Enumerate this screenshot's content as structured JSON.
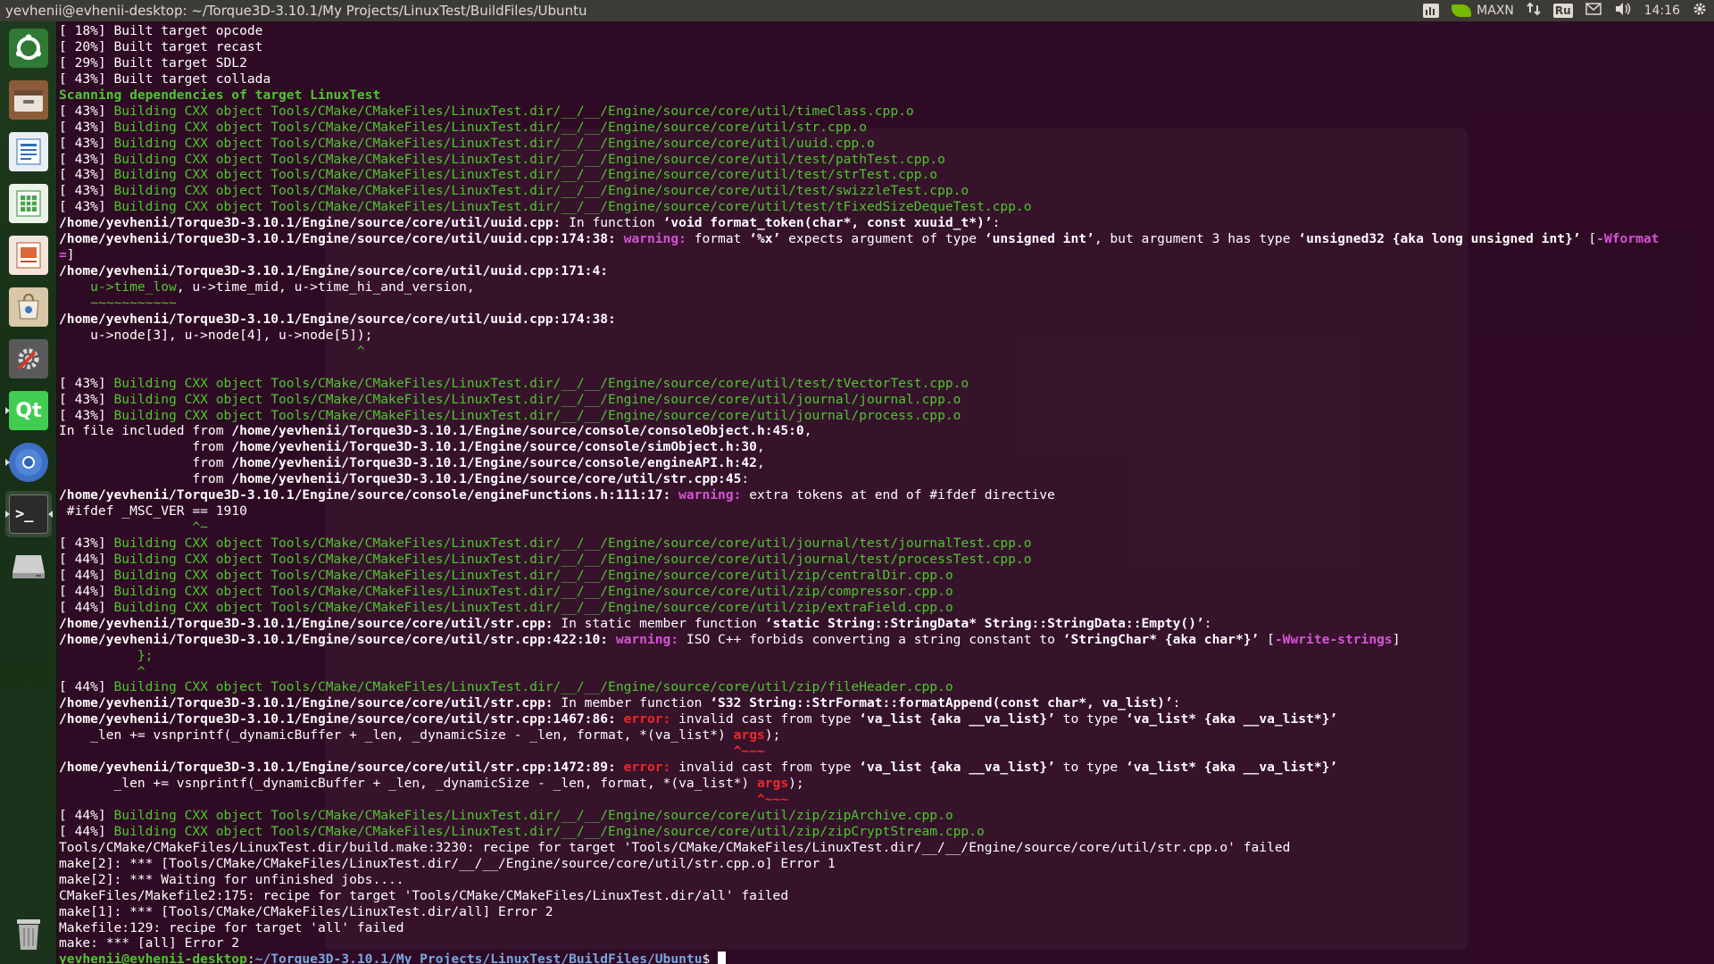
{
  "window_title": "yevhenii@evhenii-desktop: ~/Torque3D-3.10.1/My Projects/LinuxTest/BuildFiles/Ubuntu",
  "indicators": {
    "perf_mode": "MAXN",
    "keyboard_layout": "Ru",
    "time": "14:16"
  },
  "launcher": [
    {
      "name": "ubuntu-dash-icon",
      "label": ""
    },
    {
      "name": "files-icon",
      "label": ""
    },
    {
      "name": "libreoffice-writer-icon",
      "label": ""
    },
    {
      "name": "libreoffice-calc-icon",
      "label": ""
    },
    {
      "name": "libreoffice-impress-icon",
      "label": ""
    },
    {
      "name": "software-center-icon",
      "label": ""
    },
    {
      "name": "system-settings-icon",
      "label": ""
    },
    {
      "name": "qt-creator-icon",
      "label": "Qt"
    },
    {
      "name": "chromium-icon",
      "label": ""
    },
    {
      "name": "terminal-icon",
      "label": ">_"
    },
    {
      "name": "drive-icon",
      "label": ""
    },
    {
      "name": "trash-icon",
      "label": ""
    }
  ],
  "colors": {
    "terminal_bg": "#300a24",
    "green": "#4ec72d",
    "warning": "#d454d4",
    "error": "#ef2929",
    "prompt_path": "#7aa7e0"
  },
  "terminal_lines": [
    [
      [
        "d",
        "[ 18%] Built target opcode"
      ]
    ],
    [
      [
        "d",
        "[ 20%] Built target recast"
      ]
    ],
    [
      [
        "d",
        "[ 29%] Built target SDL2"
      ]
    ],
    [
      [
        "d",
        "[ 43%] Built target collada"
      ]
    ],
    [
      [
        "gb",
        "Scanning dependencies of target LinuxTest"
      ]
    ],
    [
      [
        "d",
        "[ 43%] "
      ],
      [
        "g",
        "Building CXX object Tools/CMake/CMakeFiles/LinuxTest.dir/__/__/Engine/source/core/util/timeClass.cpp.o"
      ]
    ],
    [
      [
        "d",
        "[ 43%] "
      ],
      [
        "g",
        "Building CXX object Tools/CMake/CMakeFiles/LinuxTest.dir/__/__/Engine/source/core/util/str.cpp.o"
      ]
    ],
    [
      [
        "d",
        "[ 43%] "
      ],
      [
        "g",
        "Building CXX object Tools/CMake/CMakeFiles/LinuxTest.dir/__/__/Engine/source/core/util/uuid.cpp.o"
      ]
    ],
    [
      [
        "d",
        "[ 43%] "
      ],
      [
        "g",
        "Building CXX object Tools/CMake/CMakeFiles/LinuxTest.dir/__/__/Engine/source/core/util/test/pathTest.cpp.o"
      ]
    ],
    [
      [
        "d",
        "[ 43%] "
      ],
      [
        "g",
        "Building CXX object Tools/CMake/CMakeFiles/LinuxTest.dir/__/__/Engine/source/core/util/test/strTest.cpp.o"
      ]
    ],
    [
      [
        "d",
        "[ 43%] "
      ],
      [
        "g",
        "Building CXX object Tools/CMake/CMakeFiles/LinuxTest.dir/__/__/Engine/source/core/util/test/swizzleTest.cpp.o"
      ]
    ],
    [
      [
        "d",
        "[ 43%] "
      ],
      [
        "g",
        "Building CXX object Tools/CMake/CMakeFiles/LinuxTest.dir/__/__/Engine/source/core/util/test/tFixedSizeDequeTest.cpp.o"
      ]
    ],
    [
      [
        "b",
        "/home/yevhenii/Torque3D-3.10.1/Engine/source/core/util/uuid.cpp:"
      ],
      [
        "d",
        " In function "
      ],
      [
        "b",
        "‘void format_token(char*, const xuuid_t*)’"
      ],
      [
        "d",
        ":"
      ]
    ],
    [
      [
        "b",
        "/home/yevhenii/Torque3D-3.10.1/Engine/source/core/util/uuid.cpp:174:38: "
      ],
      [
        "wm",
        "warning: "
      ],
      [
        "d",
        "format "
      ],
      [
        "b",
        "‘%x’"
      ],
      [
        "d",
        " expects argument of type "
      ],
      [
        "b",
        "‘unsigned int’"
      ],
      [
        "d",
        ", but argument 3 has type "
      ],
      [
        "b",
        "‘unsigned32 {aka long unsigned int}’"
      ],
      [
        "d",
        " ["
      ],
      [
        "wm",
        "-Wformat"
      ]
    ],
    [
      [
        "wm",
        "="
      ],
      [
        "d",
        "]"
      ]
    ],
    [
      [
        "b",
        "/home/yevhenii/Torque3D-3.10.1/Engine/source/core/util/uuid.cpp:171:4:"
      ]
    ],
    [
      [
        "d",
        "    "
      ],
      [
        "hl",
        "u->time_low"
      ],
      [
        "d",
        ", u->time_mid, u->time_hi_and_version,"
      ]
    ],
    [
      [
        "d",
        "    "
      ],
      [
        "hl",
        "~~~~~~~~~~~"
      ]
    ],
    [
      [
        "b",
        "/home/yevhenii/Torque3D-3.10.1/Engine/source/core/util/uuid.cpp:174:38:"
      ]
    ],
    [
      [
        "d",
        "    u->node[3], u->node[4], u->node[5]);"
      ]
    ],
    [
      [
        "d",
        "                                      "
      ],
      [
        "hl",
        "^"
      ]
    ],
    [
      [
        "d",
        " "
      ]
    ],
    [
      [
        "d",
        "[ 43%] "
      ],
      [
        "g",
        "Building CXX object Tools/CMake/CMakeFiles/LinuxTest.dir/__/__/Engine/source/core/util/test/tVectorTest.cpp.o"
      ]
    ],
    [
      [
        "d",
        "[ 43%] "
      ],
      [
        "g",
        "Building CXX object Tools/CMake/CMakeFiles/LinuxTest.dir/__/__/Engine/source/core/util/journal/journal.cpp.o"
      ]
    ],
    [
      [
        "d",
        "[ 43%] "
      ],
      [
        "g",
        "Building CXX object Tools/CMake/CMakeFiles/LinuxTest.dir/__/__/Engine/source/core/util/journal/process.cpp.o"
      ]
    ],
    [
      [
        "d",
        "In file included from "
      ],
      [
        "b",
        "/home/yevhenii/Torque3D-3.10.1/Engine/source/console/consoleObject.h:45:0"
      ],
      [
        "d",
        ","
      ]
    ],
    [
      [
        "d",
        "                 from "
      ],
      [
        "b",
        "/home/yevhenii/Torque3D-3.10.1/Engine/source/console/simObject.h:30"
      ],
      [
        "d",
        ","
      ]
    ],
    [
      [
        "d",
        "                 from "
      ],
      [
        "b",
        "/home/yevhenii/Torque3D-3.10.1/Engine/source/console/engineAPI.h:42"
      ],
      [
        "d",
        ","
      ]
    ],
    [
      [
        "d",
        "                 from "
      ],
      [
        "b",
        "/home/yevhenii/Torque3D-3.10.1/Engine/source/core/util/str.cpp:45"
      ],
      [
        "d",
        ":"
      ]
    ],
    [
      [
        "b",
        "/home/yevhenii/Torque3D-3.10.1/Engine/source/console/engineFunctions.h:111:17: "
      ],
      [
        "wm",
        "warning: "
      ],
      [
        "d",
        "extra tokens at end of #ifdef directive"
      ]
    ],
    [
      [
        "d",
        " #ifdef _MSC_VER == 1910"
      ]
    ],
    [
      [
        "d",
        "                 "
      ],
      [
        "hl",
        "^~"
      ]
    ],
    [
      [
        "d",
        "[ 43%] "
      ],
      [
        "g",
        "Building CXX object Tools/CMake/CMakeFiles/LinuxTest.dir/__/__/Engine/source/core/util/journal/test/journalTest.cpp.o"
      ]
    ],
    [
      [
        "d",
        "[ 44%] "
      ],
      [
        "g",
        "Building CXX object Tools/CMake/CMakeFiles/LinuxTest.dir/__/__/Engine/source/core/util/journal/test/processTest.cpp.o"
      ]
    ],
    [
      [
        "d",
        "[ 44%] "
      ],
      [
        "g",
        "Building CXX object Tools/CMake/CMakeFiles/LinuxTest.dir/__/__/Engine/source/core/util/zip/centralDir.cpp.o"
      ]
    ],
    [
      [
        "d",
        "[ 44%] "
      ],
      [
        "g",
        "Building CXX object Tools/CMake/CMakeFiles/LinuxTest.dir/__/__/Engine/source/core/util/zip/compressor.cpp.o"
      ]
    ],
    [
      [
        "d",
        "[ 44%] "
      ],
      [
        "g",
        "Building CXX object Tools/CMake/CMakeFiles/LinuxTest.dir/__/__/Engine/source/core/util/zip/extraField.cpp.o"
      ]
    ],
    [
      [
        "b",
        "/home/yevhenii/Torque3D-3.10.1/Engine/source/core/util/str.cpp:"
      ],
      [
        "d",
        " In static member function "
      ],
      [
        "b",
        "‘static String::StringData* String::StringData::Empty()’"
      ],
      [
        "d",
        ":"
      ]
    ],
    [
      [
        "b",
        "/home/yevhenii/Torque3D-3.10.1/Engine/source/core/util/str.cpp:422:10: "
      ],
      [
        "wm",
        "warning: "
      ],
      [
        "d",
        "ISO C++ forbids converting a string constant to "
      ],
      [
        "b",
        "‘StringChar* {aka char*}’"
      ],
      [
        "d",
        " ["
      ],
      [
        "wm",
        "-Wwrite-strings"
      ],
      [
        "d",
        "]"
      ]
    ],
    [
      [
        "d",
        "          "
      ],
      [
        "hl",
        "};"
      ]
    ],
    [
      [
        "d",
        "          "
      ],
      [
        "hl",
        "^"
      ]
    ],
    [
      [
        "d",
        "[ 44%] "
      ],
      [
        "g",
        "Building CXX object Tools/CMake/CMakeFiles/LinuxTest.dir/__/__/Engine/source/core/util/zip/fileHeader.cpp.o"
      ]
    ],
    [
      [
        "b",
        "/home/yevhenii/Torque3D-3.10.1/Engine/source/core/util/str.cpp:"
      ],
      [
        "d",
        " In member function "
      ],
      [
        "b",
        "‘S32 String::StrFormat::formatAppend(const char*, va_list)’"
      ],
      [
        "d",
        ":"
      ]
    ],
    [
      [
        "b",
        "/home/yevhenii/Torque3D-3.10.1/Engine/source/core/util/str.cpp:1467:86: "
      ],
      [
        "er",
        "error: "
      ],
      [
        "d",
        "invalid cast from type "
      ],
      [
        "b",
        "‘va_list {aka __va_list}’"
      ],
      [
        "d",
        " to type "
      ],
      [
        "b",
        "‘va_list* {aka __va_list*}’"
      ]
    ],
    [
      [
        "d",
        "    _len += vsnprintf(_dynamicBuffer + _len, _dynamicSize - _len, format, *(va_list*) "
      ],
      [
        "er",
        "args"
      ],
      [
        "d",
        ");"
      ]
    ],
    [
      [
        "d",
        "                                                                                      "
      ],
      [
        "er",
        "^~~~"
      ]
    ],
    [
      [
        "b",
        "/home/yevhenii/Torque3D-3.10.1/Engine/source/core/util/str.cpp:1472:89: "
      ],
      [
        "er",
        "error: "
      ],
      [
        "d",
        "invalid cast from type "
      ],
      [
        "b",
        "‘va_list {aka __va_list}’"
      ],
      [
        "d",
        " to type "
      ],
      [
        "b",
        "‘va_list* {aka __va_list*}’"
      ]
    ],
    [
      [
        "d",
        "       _len += vsnprintf(_dynamicBuffer + _len, _dynamicSize - _len, format, *(va_list*) "
      ],
      [
        "er",
        "args"
      ],
      [
        "d",
        ");"
      ]
    ],
    [
      [
        "d",
        "                                                                                         "
      ],
      [
        "er",
        "^~~~"
      ]
    ],
    [
      [
        "d",
        "[ 44%] "
      ],
      [
        "g",
        "Building CXX object Tools/CMake/CMakeFiles/LinuxTest.dir/__/__/Engine/source/core/util/zip/zipArchive.cpp.o"
      ]
    ],
    [
      [
        "d",
        "[ 44%] "
      ],
      [
        "g",
        "Building CXX object Tools/CMake/CMakeFiles/LinuxTest.dir/__/__/Engine/source/core/util/zip/zipCryptStream.cpp.o"
      ]
    ],
    [
      [
        "d",
        "Tools/CMake/CMakeFiles/LinuxTest.dir/build.make:3230: recipe for target 'Tools/CMake/CMakeFiles/LinuxTest.dir/__/__/Engine/source/core/util/str.cpp.o' failed"
      ]
    ],
    [
      [
        "d",
        "make[2]: *** [Tools/CMake/CMakeFiles/LinuxTest.dir/__/__/Engine/source/core/util/str.cpp.o] Error 1"
      ]
    ],
    [
      [
        "d",
        "make[2]: *** Waiting for unfinished jobs...."
      ]
    ],
    [
      [
        "d",
        "CMakeFiles/Makefile2:175: recipe for target 'Tools/CMake/CMakeFiles/LinuxTest.dir/all' failed"
      ]
    ],
    [
      [
        "d",
        "make[1]: *** [Tools/CMake/CMakeFiles/LinuxTest.dir/all] Error 2"
      ]
    ],
    [
      [
        "d",
        "Makefile:129: recipe for target 'all' failed"
      ]
    ],
    [
      [
        "d",
        "make: *** [all] Error 2"
      ]
    ]
  ],
  "prompt": {
    "user_host": "yevhenii@evhenii-desktop",
    "sep": ":",
    "path": "~/Torque3D-3.10.1/My Projects/LinuxTest/BuildFiles/Ubuntu",
    "symbol": "$ "
  }
}
